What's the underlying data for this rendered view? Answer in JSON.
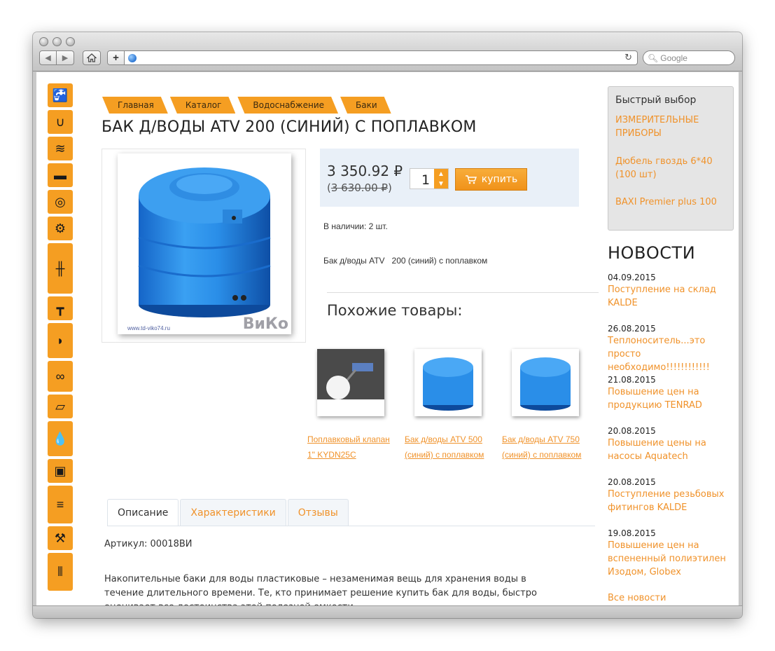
{
  "browser": {
    "search_placeholder": "Google",
    "icons": [
      "back-icon",
      "forward-icon",
      "home-icon",
      "add-bookmark-icon",
      "globe-icon",
      "reload-icon",
      "search-icon"
    ]
  },
  "category_icons": [
    {
      "name": "faucet-icon",
      "glyph": "🚰"
    },
    {
      "name": "siphon-icon",
      "glyph": "∪"
    },
    {
      "name": "heating-coil-icon",
      "glyph": "≋"
    },
    {
      "name": "pipe-machine-icon",
      "glyph": "▬"
    },
    {
      "name": "pipe-roll-icon",
      "glyph": "◎"
    },
    {
      "name": "gears-icon",
      "glyph": "⚙"
    },
    {
      "name": "valve-icon",
      "glyph": "╫"
    },
    {
      "name": "ball-valve-icon",
      "glyph": "┳"
    },
    {
      "name": "shower-icon",
      "glyph": "◗"
    },
    {
      "name": "seal-rings-icon",
      "glyph": "∞"
    },
    {
      "name": "pipe-icon",
      "glyph": "▱"
    },
    {
      "name": "drop-icon",
      "glyph": "💧"
    },
    {
      "name": "boiler-icon",
      "glyph": "▣"
    },
    {
      "name": "radiator-icon",
      "glyph": "≡"
    },
    {
      "name": "hammer-icon",
      "glyph": "⚒"
    },
    {
      "name": "heater-icon",
      "glyph": "⦀"
    }
  ],
  "breadcrumbs": [
    "Главная",
    "Каталог",
    "Водоснабжение",
    "Баки"
  ],
  "product": {
    "title": "БАК Д/ВОДЫ ATV 200 (СИНИЙ) С ПОПЛАВКОМ",
    "price": "3 350.92 ₽",
    "old_price": "3 630.00 ₽",
    "old_price_open": "(",
    "old_price_close": ")",
    "quantity": "1",
    "buy_label": "купить",
    "stock": "В наличии: 2 шт.",
    "short_description": "Бак д/воды ATV   200 (синий) с поплавком",
    "image_watermark": "ВиКо",
    "image_url_text": "www.td-viko74.ru"
  },
  "similar": {
    "heading": "Похожие товары:",
    "items": [
      {
        "caption": "Поплавковый клапан 1\" KYDN25C"
      },
      {
        "caption": "Бак д/воды ATV 500 (синий) с поплавком"
      },
      {
        "caption": "Бак д/воды ATV 750 (синий) с поплавком"
      }
    ]
  },
  "tabs": [
    {
      "label": "Описание",
      "active": true
    },
    {
      "label": "Характеристики",
      "active": false
    },
    {
      "label": "Отзывы",
      "active": false
    }
  ],
  "details": {
    "article": "Артикул: 00018ВИ",
    "description": "Накопительные баки для воды пластиковые – незаменимая вещь для хранения воды в течение длительного времени. Те, кто принимает решение купить бак для воды, быстро оценивает все достоинства этой полезной емкости."
  },
  "quick_select": {
    "heading": "Быстрый выбор",
    "links": [
      "ИЗМЕРИТЕЛЬНЫЕ ПРИБОРЫ",
      "Дюбель гвоздь 6*40 (100 шт)",
      "BAXI Premier plus 100"
    ]
  },
  "news": {
    "heading": "НОВОСТИ",
    "items": [
      {
        "date": "04.09.2015",
        "title": "Поступление на склад KALDE"
      },
      {
        "date": "26.08.2015",
        "title": "Теплоноситель...это просто необходимо!!!!!!!!!!!!"
      },
      {
        "date": "21.08.2015",
        "title": "Повышение цен на продукцию TENRAD"
      },
      {
        "date": "20.08.2015",
        "title": "Повышение цены на насосы Aquatech"
      },
      {
        "date": "20.08.2015",
        "title": "Поступление резьбовых фитингов KALDE"
      },
      {
        "date": "19.08.2015",
        "title": "Повышение цен на вспененный полиэтилен Изодом, Globex"
      }
    ],
    "all_link": "Все новости"
  },
  "colors": {
    "accent": "#f59e22",
    "link": "#f0922a",
    "price_box": "#e9f0f8"
  }
}
